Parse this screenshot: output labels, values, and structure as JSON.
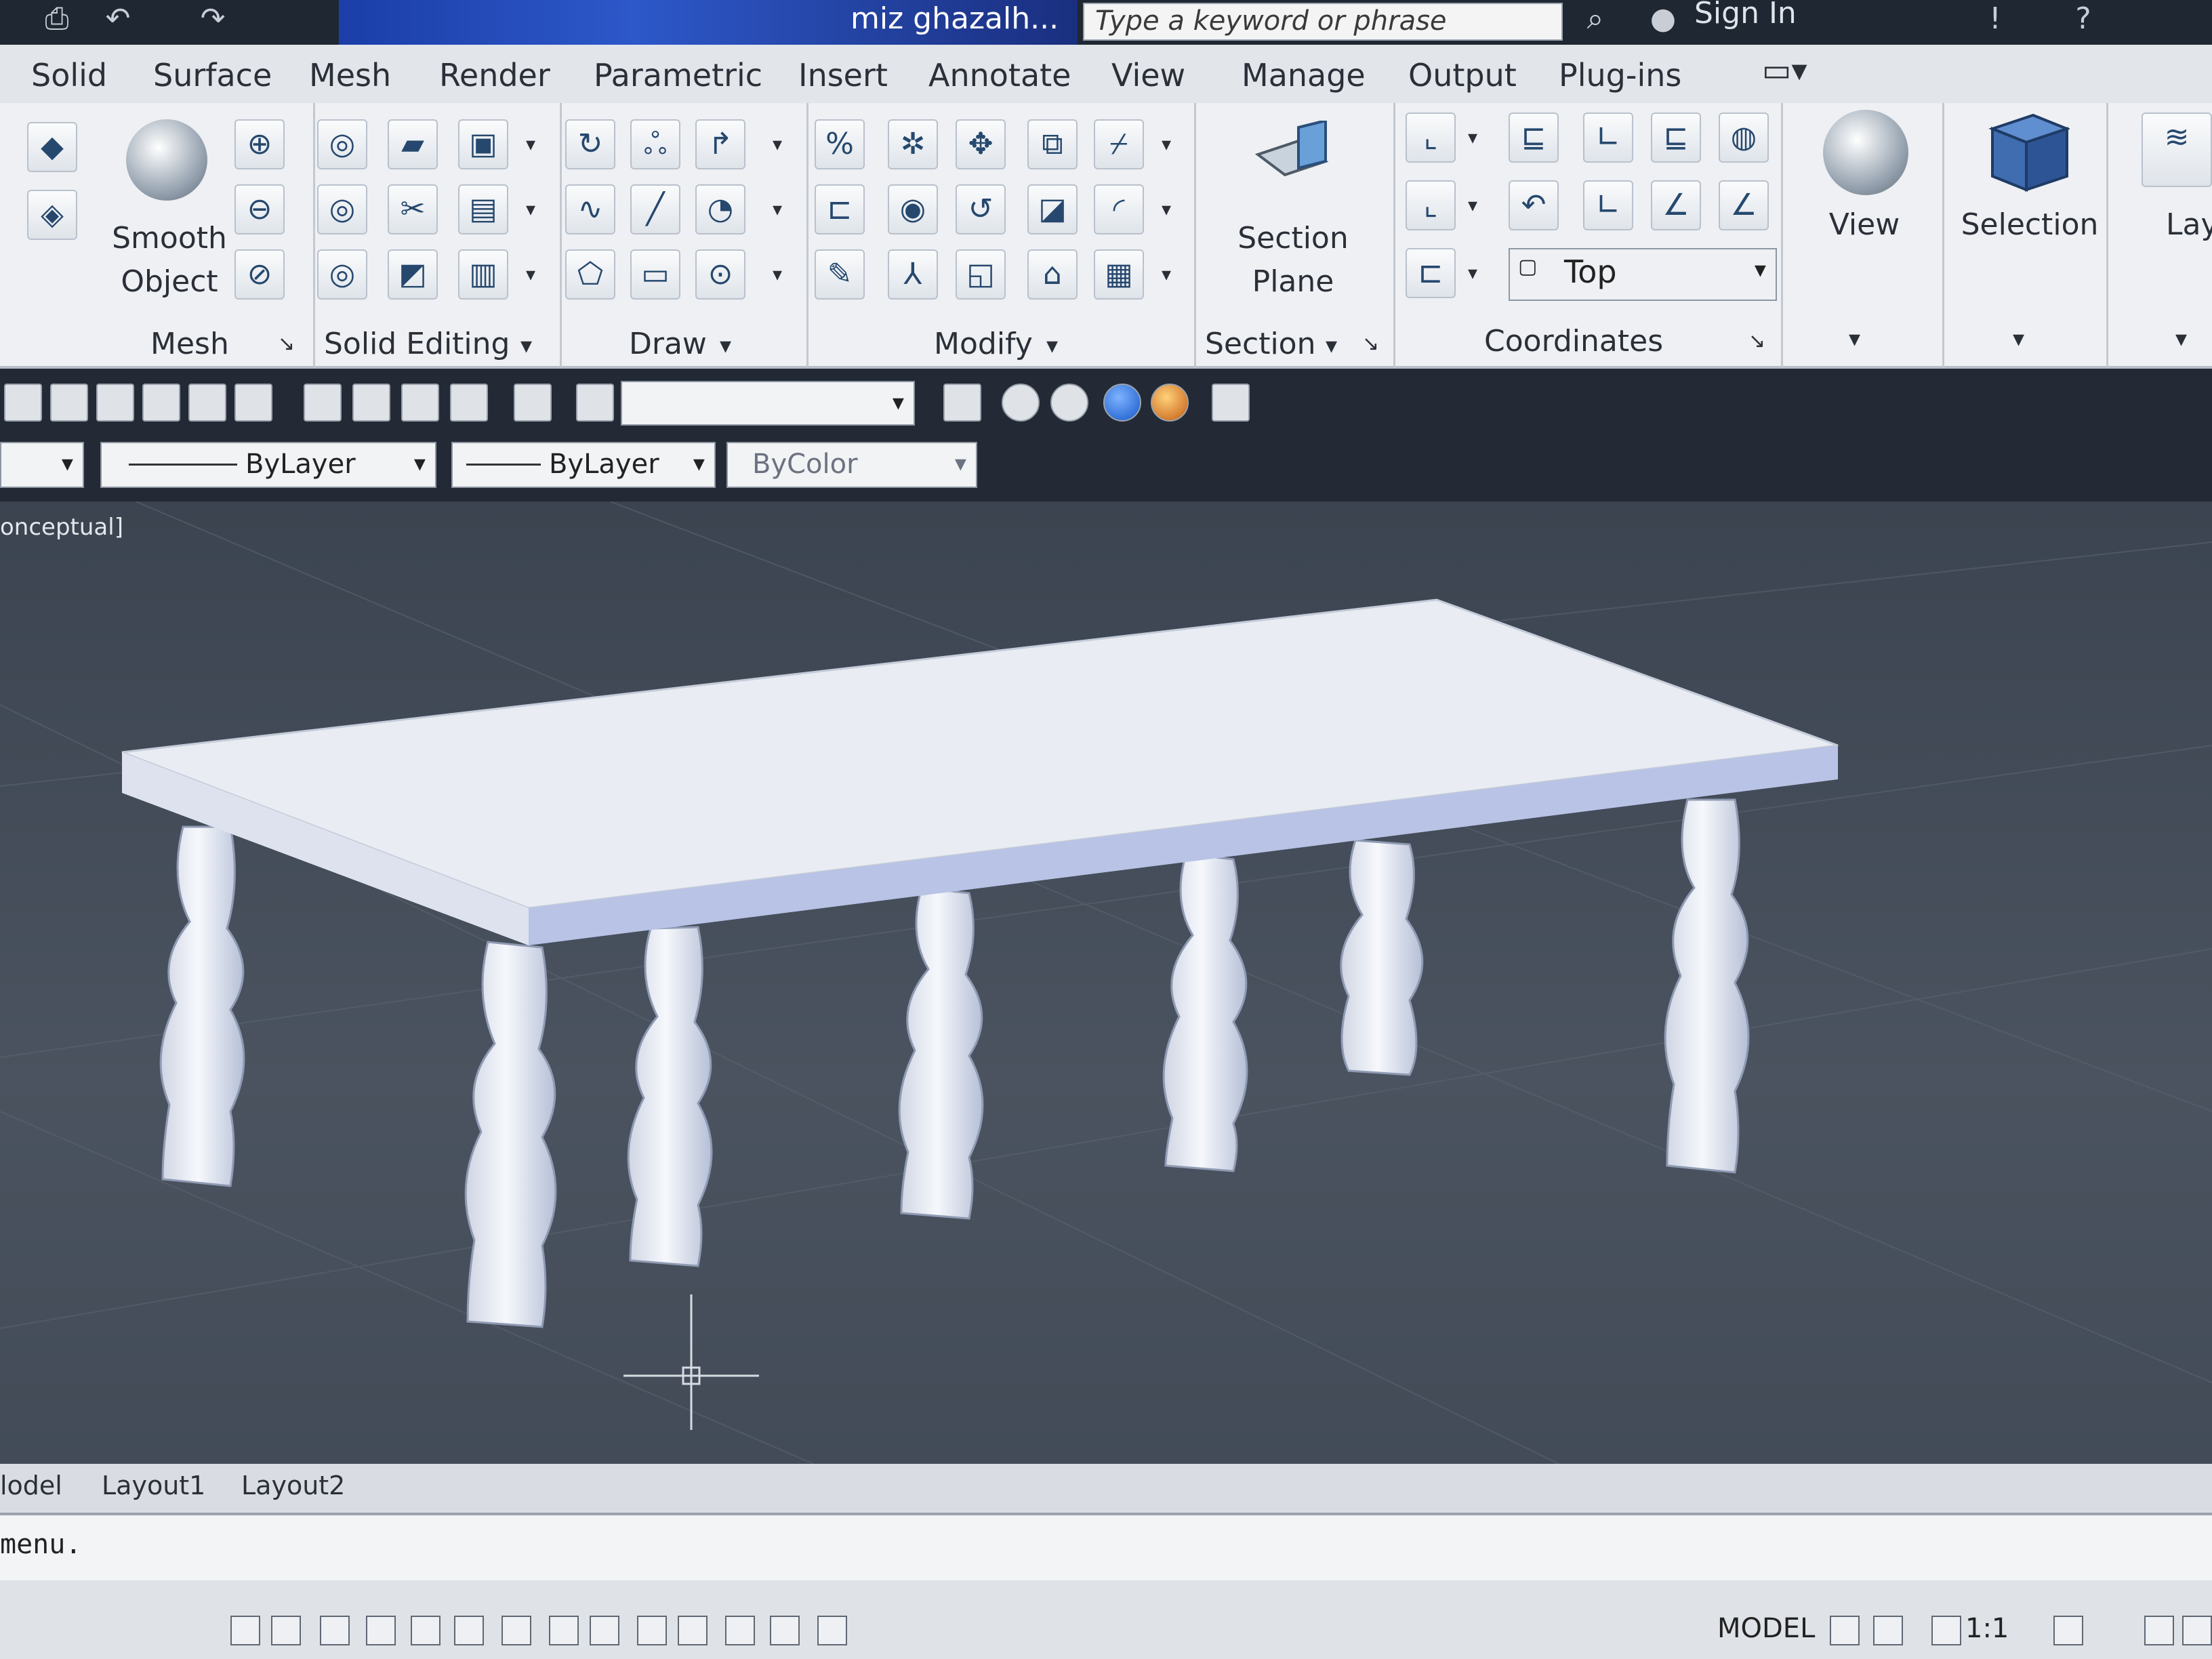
{
  "title_bar": {
    "document_title": "miz ghazalh...",
    "search_placeholder": "Type a keyword or phrase",
    "sign_in": "Sign In"
  },
  "ribbon_tabs": [
    "Solid",
    "Surface",
    "Mesh",
    "Render",
    "Parametric",
    "Insert",
    "Annotate",
    "View",
    "Manage",
    "Output",
    "Plug-ins"
  ],
  "ribbon_panels": {
    "mesh": {
      "label": "Mesh",
      "big_button": "Smooth\nObject"
    },
    "solid_editing": {
      "label": "Solid Editing"
    },
    "draw": {
      "label": "Draw"
    },
    "modify": {
      "label": "Modify"
    },
    "section": {
      "label": "Section",
      "big_button": "Section\nPlane"
    },
    "coordinates": {
      "label": "Coordinates",
      "view_combo": "Top"
    },
    "view": {
      "label": "View"
    },
    "selection": {
      "label": "Selection"
    },
    "layers": {
      "label": "Laye"
    }
  },
  "property_bar": {
    "linetype": "ByLayer",
    "lineweight": "ByLayer",
    "plotstyle": "ByColor"
  },
  "viewport": {
    "visual_style": "onceptual]"
  },
  "layout_tabs": [
    "lodel",
    "Layout1",
    "Layout2"
  ],
  "command_line": "menu.",
  "status": {
    "model": "MODEL",
    "scale": "1:1"
  },
  "colors": {
    "accent": "#1b3ea8",
    "viewport_bg": "#454e5a",
    "table_top": "#e9ecf2",
    "table_side": "#b8c3e6",
    "legs": "#edf0f6"
  }
}
